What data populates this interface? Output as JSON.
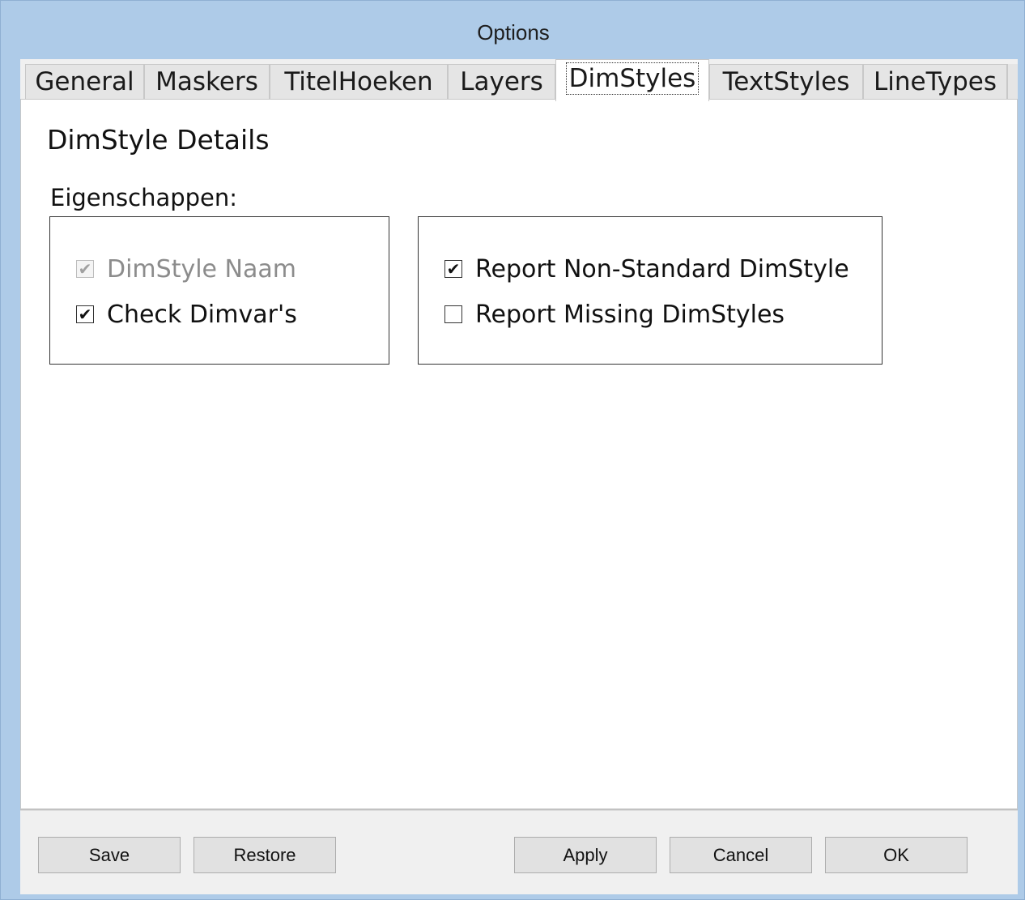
{
  "window": {
    "title": "Options"
  },
  "tabs": [
    {
      "label": "General",
      "active": false
    },
    {
      "label": "Maskers",
      "active": false
    },
    {
      "label": "TitelHoeken",
      "active": false
    },
    {
      "label": "Layers",
      "active": false
    },
    {
      "label": "DimStyles",
      "active": true
    },
    {
      "label": "TextStyles",
      "active": false
    },
    {
      "label": "LineTypes",
      "active": false
    }
  ],
  "page": {
    "title": "DimStyle Details",
    "properties_label": "Eigenschappen:",
    "left_group": [
      {
        "label": "DimStyle Naam",
        "checked": true,
        "enabled": false
      },
      {
        "label": "Check Dimvar's",
        "checked": true,
        "enabled": true
      }
    ],
    "right_group": [
      {
        "label": "Report Non-Standard DimStyle",
        "checked": true,
        "enabled": true
      },
      {
        "label": "Report Missing DimStyles",
        "checked": false,
        "enabled": true
      }
    ]
  },
  "buttons": {
    "save": "Save",
    "restore": "Restore",
    "apply": "Apply",
    "cancel": "Cancel",
    "ok": "OK"
  },
  "icons": {
    "check_mark": "✔"
  },
  "colors": {
    "window_frame": "#aecbe8",
    "dialog_background": "#f0f0f0",
    "disabled_text": "#8c8c8c"
  }
}
